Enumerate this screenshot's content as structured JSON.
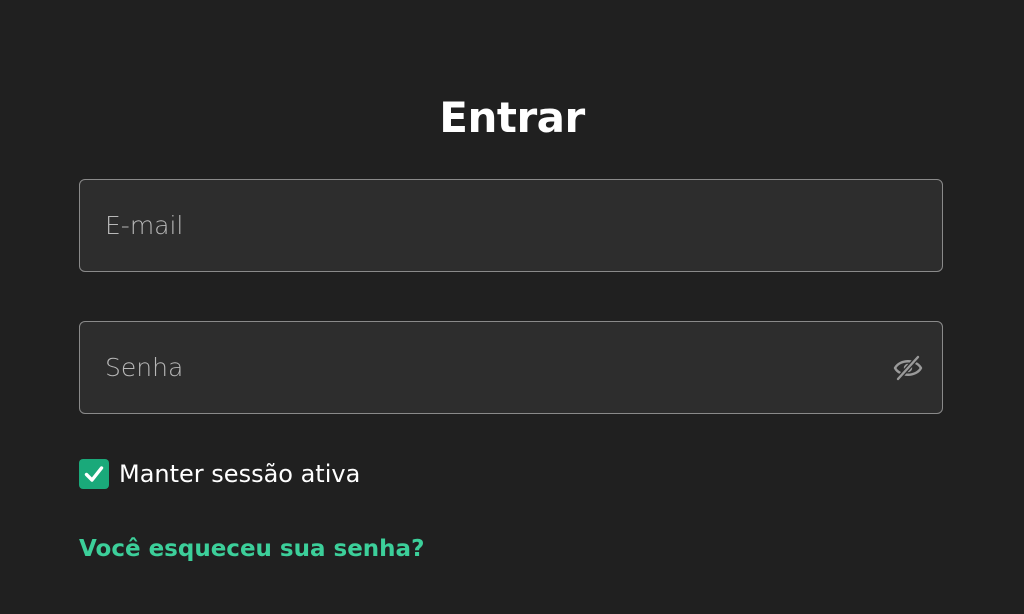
{
  "login": {
    "title": "Entrar",
    "email": {
      "placeholder": "E-mail",
      "value": ""
    },
    "password": {
      "placeholder": "Senha",
      "value": "",
      "toggle_icon": "eye-off-icon"
    },
    "remember": {
      "label": "Manter sessão ativa",
      "checked": true,
      "check_icon": "check-icon"
    },
    "forgot_link": "Você esqueceu sua senha?"
  },
  "colors": {
    "background": "#202020",
    "field_background": "#2d2d2d",
    "field_border": "#8a8a8a",
    "accent": "#1aa97a",
    "link": "#3ccf9a",
    "placeholder": "#b8b8b8"
  }
}
